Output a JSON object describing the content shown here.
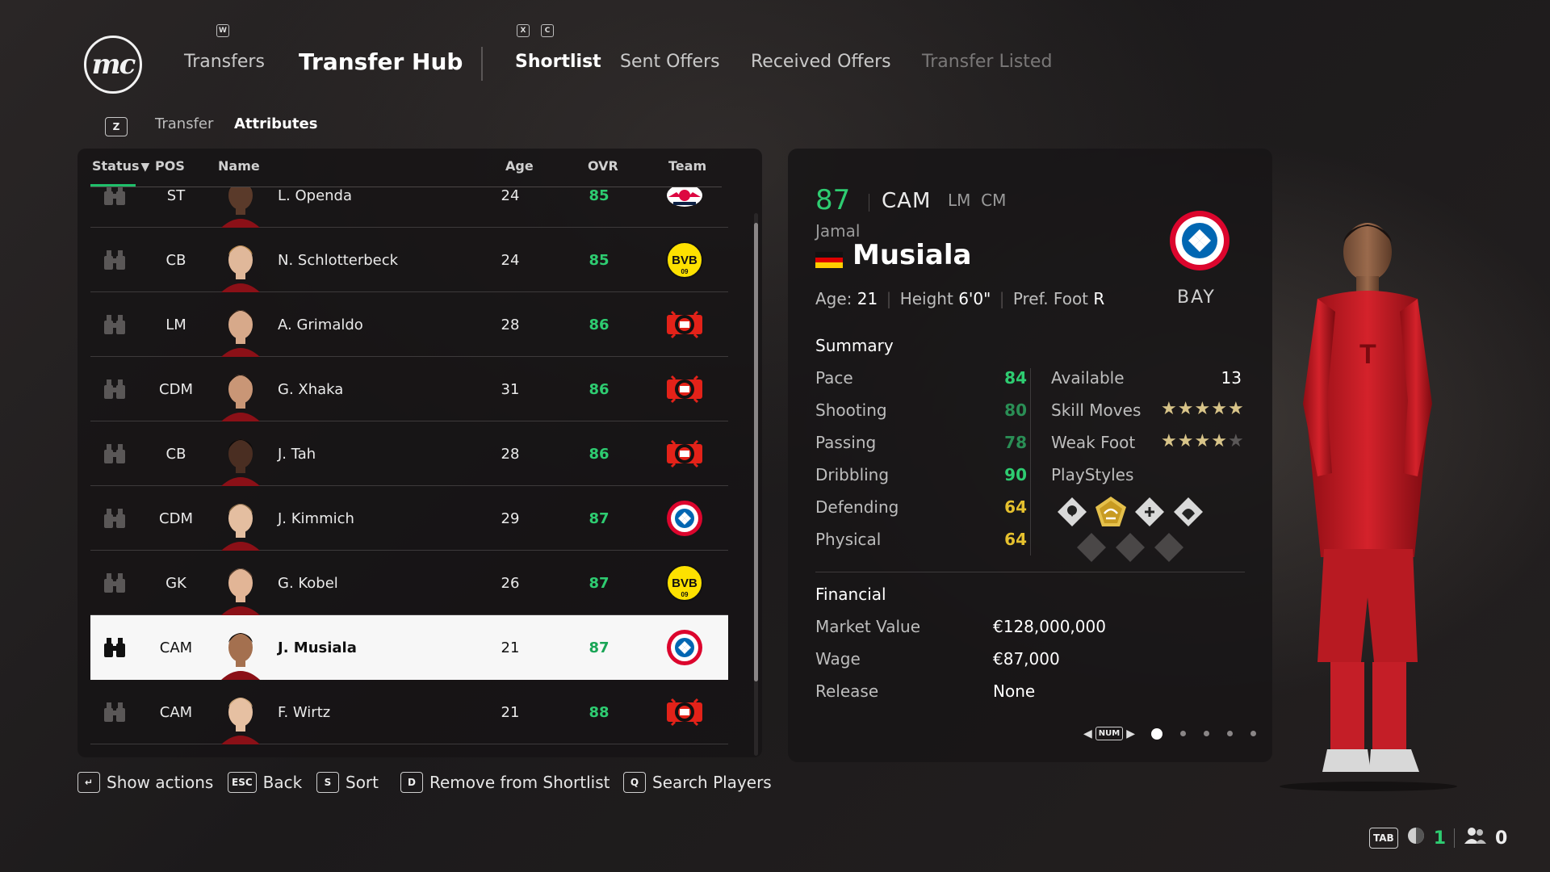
{
  "header": {
    "logo": "mc",
    "key_w": "W",
    "key_x": "X",
    "key_c": "C",
    "transfers": "Transfers",
    "title": "Transfer Hub",
    "tabs": [
      "Shortlist",
      "Sent Offers",
      "Received Offers",
      "Transfer Listed"
    ]
  },
  "subnav": {
    "key": "Z",
    "items": [
      "Transfer",
      "Attributes"
    ]
  },
  "list": {
    "columns": {
      "status": "Status",
      "status_arrow": "▼",
      "pos": "POS",
      "name": "Name",
      "age": "Age",
      "ovr": "OVR",
      "team": "Team"
    },
    "rows": [
      {
        "pos": "ST",
        "name": "L. Openda",
        "age": "24",
        "ovr": "85",
        "team_icon": "rb-leipzig-crest-icon",
        "selected": false
      },
      {
        "pos": "CB",
        "name": "N. Schlotterbeck",
        "age": "24",
        "ovr": "85",
        "team_icon": "bvb-crest-icon",
        "selected": false
      },
      {
        "pos": "LM",
        "name": "A. Grimaldo",
        "age": "28",
        "ovr": "86",
        "team_icon": "leverkusen-crest-icon",
        "selected": false
      },
      {
        "pos": "CDM",
        "name": "G. Xhaka",
        "age": "31",
        "ovr": "86",
        "team_icon": "leverkusen-crest-icon",
        "selected": false
      },
      {
        "pos": "CB",
        "name": "J. Tah",
        "age": "28",
        "ovr": "86",
        "team_icon": "leverkusen-crest-icon",
        "selected": false
      },
      {
        "pos": "CDM",
        "name": "J. Kimmich",
        "age": "29",
        "ovr": "87",
        "team_icon": "bayern-crest-icon",
        "selected": false
      },
      {
        "pos": "GK",
        "name": "G. Kobel",
        "age": "26",
        "ovr": "87",
        "team_icon": "bvb-crest-icon",
        "selected": false
      },
      {
        "pos": "CAM",
        "name": "J. Musiala",
        "age": "21",
        "ovr": "87",
        "team_icon": "bayern-crest-icon",
        "selected": true
      },
      {
        "pos": "CAM",
        "name": "F. Wirtz",
        "age": "21",
        "ovr": "88",
        "team_icon": "leverkusen-crest-icon",
        "selected": false
      }
    ]
  },
  "player": {
    "ovr": "87",
    "position": "CAM",
    "alt_positions": "LM  CM",
    "first_name": "Jamal",
    "last_name": "Musiala",
    "age_label": "Age:",
    "age": "21",
    "height_label": "Height",
    "height": "6'0\"",
    "foot_label": "Pref. Foot",
    "foot": "R",
    "club_abbr": "BAY",
    "summary_title": "Summary",
    "stats": [
      {
        "label": "Pace",
        "value": "84"
      },
      {
        "label": "Shooting",
        "value": "80"
      },
      {
        "label": "Passing",
        "value": "78"
      },
      {
        "label": "Dribbling",
        "value": "90"
      },
      {
        "label": "Defending",
        "value": "64"
      },
      {
        "label": "Physical",
        "value": "64"
      }
    ],
    "available_label": "Available",
    "available": "13",
    "skill_moves_label": "Skill Moves",
    "skill_moves": 5,
    "weak_foot_label": "Weak Foot",
    "weak_foot": 4,
    "playstyles_label": "PlayStyles",
    "financial_title": "Financial",
    "market_value_label": "Market Value",
    "market_value": "€128,000,000",
    "wage_label": "Wage",
    "wage": "€87,000",
    "release_label": "Release",
    "release": "None",
    "pager_key": "NUM",
    "pager_pages": 5,
    "pager_active": 1
  },
  "footer": [
    {
      "key": "↵",
      "label": "Show actions"
    },
    {
      "key": "ESC",
      "label": "Back"
    },
    {
      "key": "S",
      "label": "Sort"
    },
    {
      "key": "D",
      "label": "Remove from Shortlist"
    },
    {
      "key": "Q",
      "label": "Search Players"
    }
  ],
  "hud": {
    "tab_key": "TAB",
    "count_a": "1",
    "count_b": "0"
  },
  "colors": {
    "ovr_green": "#2ecc71",
    "stat_yellow": "#e6c12e",
    "gold_star": "#d8c489",
    "bayern_red": "#dc052d"
  }
}
